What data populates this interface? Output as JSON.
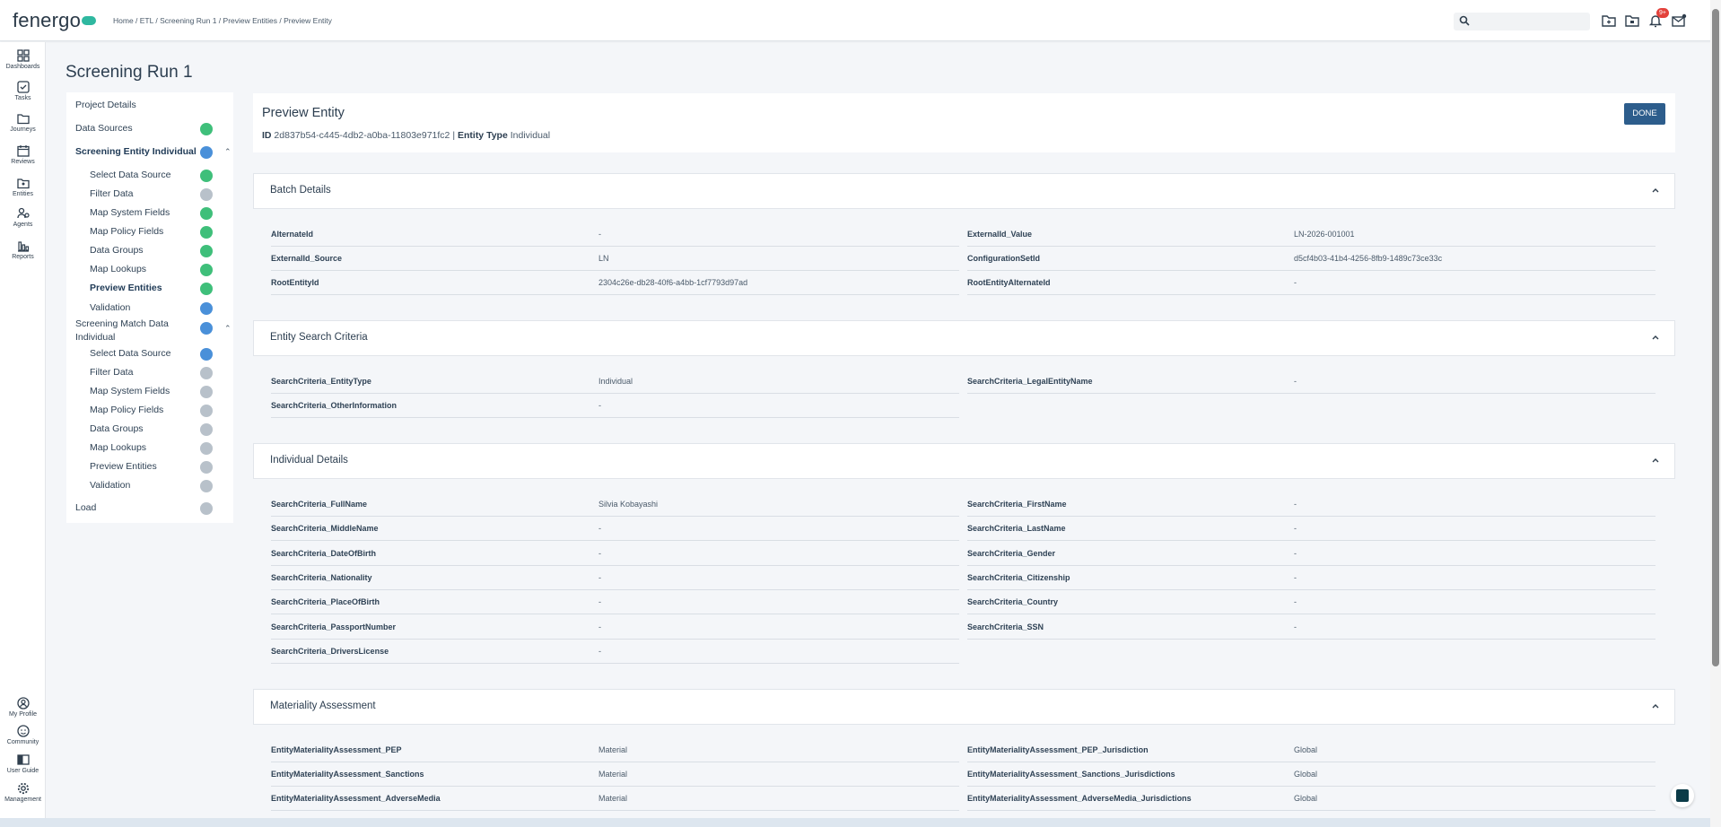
{
  "header": {
    "logo": "fenergo",
    "breadcrumb": "Home / ETL / Screening Run 1 / Preview Entities / Preview Entity",
    "notification_count": "9+"
  },
  "nav": {
    "dashboards": "Dashboards",
    "tasks": "Tasks",
    "journeys": "Journeys",
    "reviews": "Reviews",
    "entities": "Entities",
    "agents": "Agents",
    "reports": "Reports",
    "my_profile": "My Profile",
    "community": "Community",
    "user_guide": "User Guide",
    "management": "Management"
  },
  "page": {
    "title": "Screening Run 1"
  },
  "steps": {
    "project_details": "Project Details",
    "data_sources": "Data Sources",
    "screening_entity": "Screening Entity Individual",
    "se_select": "Select Data Source",
    "se_filter": "Filter Data",
    "se_map_system": "Map System Fields",
    "se_map_policy": "Map Policy Fields",
    "se_groups": "Data Groups",
    "se_lookups": "Map Lookups",
    "se_preview": "Preview Entities",
    "se_validation": "Validation",
    "screening_match_1": "Screening Match Data",
    "screening_match_2": "Individual",
    "sm_select": "Select Data Source",
    "sm_filter": "Filter Data",
    "sm_map_system": "Map System Fields",
    "sm_map_policy": "Map Policy Fields",
    "sm_groups": "Data Groups",
    "sm_lookups": "Map Lookups",
    "sm_preview": "Preview Entities",
    "sm_validation": "Validation",
    "load": "Load"
  },
  "preview": {
    "title": "Preview Entity",
    "id_label": "ID",
    "id_value": "2d837b54-c445-4db2-a0ba-11803e971fc2",
    "separator": "|",
    "type_label": "Entity Type",
    "type_value": "Individual",
    "done_label": "DONE"
  },
  "sections": {
    "batch": {
      "title": "Batch Details",
      "fields": [
        {
          "label": "AlternateId",
          "value": "-"
        },
        {
          "label": "ExternalId_Value",
          "value": "LN-2026-001001"
        },
        {
          "label": "ExternalId_Source",
          "value": "LN"
        },
        {
          "label": "ConfigurationSetId",
          "value": "d5cf4b03-41b4-4256-8fb9-1489c73ce33c"
        },
        {
          "label": "RootEntityId",
          "value": "2304c26e-db28-40f6-a4bb-1cf7793d97ad"
        },
        {
          "label": "RootEntityAlternateId",
          "value": "-"
        }
      ]
    },
    "search": {
      "title": "Entity Search Criteria",
      "fields": [
        {
          "label": "SearchCriteria_EntityType",
          "value": "Individual"
        },
        {
          "label": "SearchCriteria_LegalEntityName",
          "value": "-"
        },
        {
          "label": "SearchCriteria_OtherInformation",
          "value": "-"
        }
      ]
    },
    "individual": {
      "title": "Individual Details",
      "fields": [
        {
          "label": "SearchCriteria_FullName",
          "value": "Silvia Kobayashi"
        },
        {
          "label": "SearchCriteria_FirstName",
          "value": "-"
        },
        {
          "label": "SearchCriteria_MiddleName",
          "value": "-"
        },
        {
          "label": "SearchCriteria_LastName",
          "value": "-"
        },
        {
          "label": "SearchCriteria_DateOfBirth",
          "value": "-"
        },
        {
          "label": "SearchCriteria_Gender",
          "value": "-"
        },
        {
          "label": "SearchCriteria_Nationality",
          "value": "-"
        },
        {
          "label": "SearchCriteria_Citizenship",
          "value": "-"
        },
        {
          "label": "SearchCriteria_PlaceOfBirth",
          "value": "-"
        },
        {
          "label": "SearchCriteria_Country",
          "value": "-"
        },
        {
          "label": "SearchCriteria_PassportNumber",
          "value": "-"
        },
        {
          "label": "SearchCriteria_SSN",
          "value": "-"
        },
        {
          "label": "SearchCriteria_DriversLicense",
          "value": "-"
        }
      ]
    },
    "materiality": {
      "title": "Materiality Assessment",
      "fields": [
        {
          "label": "EntityMaterialityAssessment_PEP",
          "value": "Material"
        },
        {
          "label": "EntityMaterialityAssessment_PEP_Jurisdiction",
          "value": "Global"
        },
        {
          "label": "EntityMaterialityAssessment_Sanctions",
          "value": "Material"
        },
        {
          "label": "EntityMaterialityAssessment_Sanctions_Jurisdictions",
          "value": "Global"
        },
        {
          "label": "EntityMaterialityAssessment_AdverseMedia",
          "value": "Material"
        },
        {
          "label": "EntityMaterialityAssessment_AdverseMedia_Jurisdictions",
          "value": "Global"
        }
      ]
    }
  },
  "colors": {
    "accent": "#2d5d8c",
    "check": "#3fbf7a",
    "current": "#4a90d9",
    "pending": "#b8c1ca"
  }
}
